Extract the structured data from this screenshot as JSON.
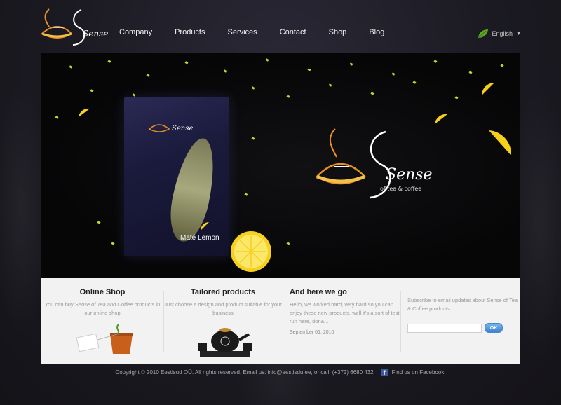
{
  "brand": {
    "logo_text": "Sense",
    "tagline": "of tea & coffee"
  },
  "nav": [
    "Company",
    "Products",
    "Services",
    "Contact",
    "Shop",
    "Blog"
  ],
  "language": {
    "selected": "English"
  },
  "hero": {
    "product_name": "Maté Lemon",
    "brand_text": "Sense",
    "brand_tagline": "of tea & coffee"
  },
  "sections": {
    "online_shop": {
      "title": "Online Shop",
      "text_pre": "You can buy ",
      "text_em": "Sense of Tea and Coffee",
      "text_post": " products in our online shop"
    },
    "tailored": {
      "title": "Tailored products",
      "text": "Just choose a design and product suitable for your business"
    },
    "news": {
      "title": "And here we go",
      "text": "Hello, we worked hard, very hard so you can enjoy these new products. well it's a sort of test run here, don&...",
      "date": "September 01, 2010"
    },
    "subscribe": {
      "text": "Subscribe to email updates about Sense of Tea & Coffee products",
      "email_placeholder": "",
      "button_label": "OK"
    }
  },
  "footer": {
    "copyright": "Copyright © 2010 Eestisud OÜ. All rights reserved. Email us: info@eestisdu.ee, or call: (+372) 6680 432",
    "facebook": "Find us on Facebook."
  },
  "colors": {
    "accent_orange": "#e8901e",
    "lime": "#c8d62a",
    "band_bg": "#f2f2f2",
    "button_blue": "#3c82cf"
  }
}
